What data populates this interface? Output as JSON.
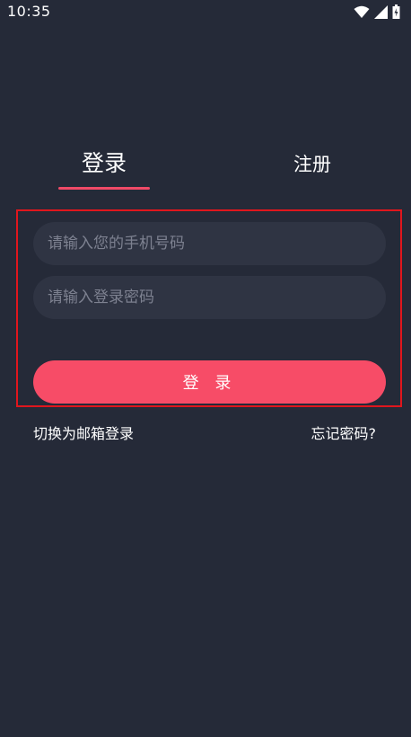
{
  "status_bar": {
    "time": "10:35",
    "icons": [
      "wifi-icon",
      "signal-icon",
      "battery-icon"
    ]
  },
  "tabs": {
    "login_label": "登录",
    "register_label": "注册",
    "active": "login"
  },
  "form": {
    "phone_placeholder": "请输入您的手机号码",
    "phone_value": "",
    "password_placeholder": "请输入登录密码",
    "password_value": "",
    "submit_label": "登 录"
  },
  "links": {
    "switch_email_label": "切换为邮箱登录",
    "forgot_password_label": "忘记密码?"
  },
  "colors": {
    "background": "#252a38",
    "input_background": "#2f3443",
    "accent": "#f74c67",
    "highlight_border": "#e0161d"
  }
}
